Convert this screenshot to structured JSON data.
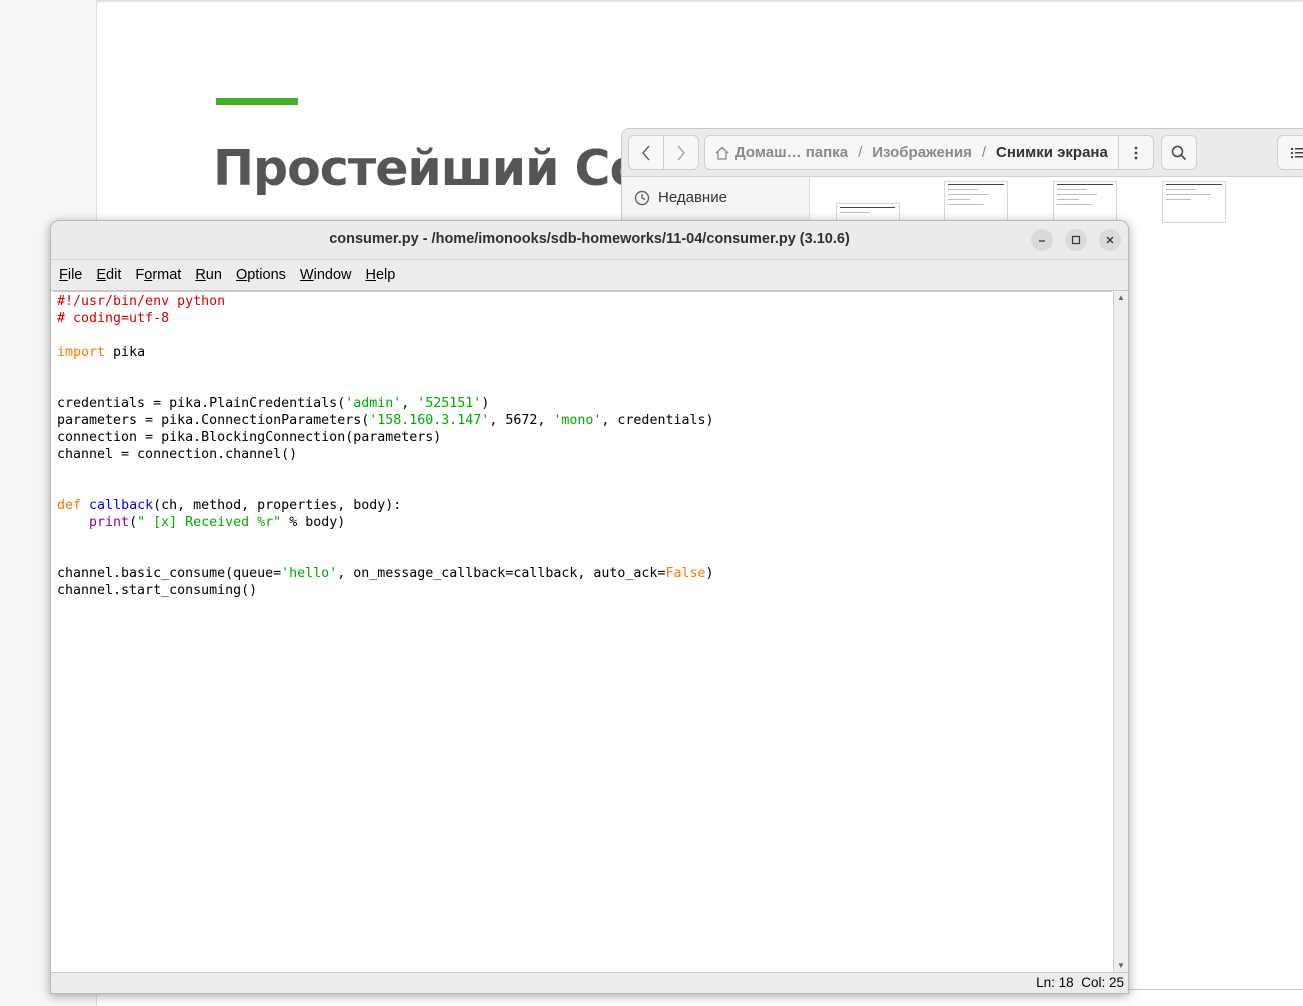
{
  "background_doc": {
    "slide_title": "Простейший Cons",
    "accent_color": "#43b02a"
  },
  "file_manager": {
    "path": {
      "home": "Домаш… папка",
      "pictures": "Изображения",
      "current": "Снимки экрана",
      "sep1": "/",
      "sep2": "/"
    },
    "sidebar": {
      "recent_label": "Недавние"
    },
    "icons": {
      "back": "chevron-left-icon",
      "forward": "chevron-right-icon",
      "home": "home-icon",
      "menu": "kebab-menu-icon",
      "search": "search-icon",
      "view": "list-view-icon",
      "recent": "clock-icon"
    }
  },
  "idle_window": {
    "title": "consumer.py - /home/imonooks/sdb-homeworks/11-04/consumer.py (3.10.6)",
    "menu": [
      {
        "key": "F",
        "rest": "ile"
      },
      {
        "key": "E",
        "rest": "dit"
      },
      {
        "key": "",
        "pre": "F",
        "key2": "o",
        "rest": "rmat"
      },
      {
        "key": "R",
        "rest": "un"
      },
      {
        "key": "O",
        "rest": "ptions"
      },
      {
        "key": "W",
        "rest": "indow"
      },
      {
        "key": "H",
        "rest": "elp"
      }
    ],
    "menu_labels": [
      "File",
      "Edit",
      "Format",
      "Run",
      "Options",
      "Window",
      "Help"
    ],
    "status": {
      "line": "Ln: 18",
      "col": "Col: 25"
    },
    "code": {
      "shebang": "#!/usr/bin/env python",
      "coding": "# coding=utf-8",
      "import_kw": "import",
      "import_mod": " pika",
      "cred_pre": "credentials = pika.PlainCredentials(",
      "cred_user": "'admin'",
      "cred_mid": ", ",
      "cred_pass": "'525151'",
      "cred_post": ")",
      "param_pre": "parameters = pika.ConnectionParameters(",
      "param_host": "'158.160.3.147'",
      "param_mid": ", 5672, ",
      "param_vhost": "'mono'",
      "param_post": ", credentials)",
      "conn": "connection = pika.BlockingConnection(parameters)",
      "chan": "channel = connection.channel()",
      "def_kw": "def",
      "def_name": "callback",
      "def_args": "(ch, method, properties, body):",
      "print_indent": "    ",
      "print_fn": "print",
      "print_open": "(",
      "print_str": "\" [x] Received %r\"",
      "print_post": " % body)",
      "consume_pre": "channel.basic_consume(queue=",
      "consume_queue": "'hello'",
      "consume_mid": ", on_message_callback=callback, auto_ack=",
      "consume_false": "False",
      "consume_post": ")",
      "start": "channel.start_consuming()"
    },
    "colors": {
      "comment": "#dd0000",
      "keyword": "#ff7700",
      "string": "#00aa00",
      "definition": "#0000ff",
      "builtin": "#900090"
    }
  }
}
